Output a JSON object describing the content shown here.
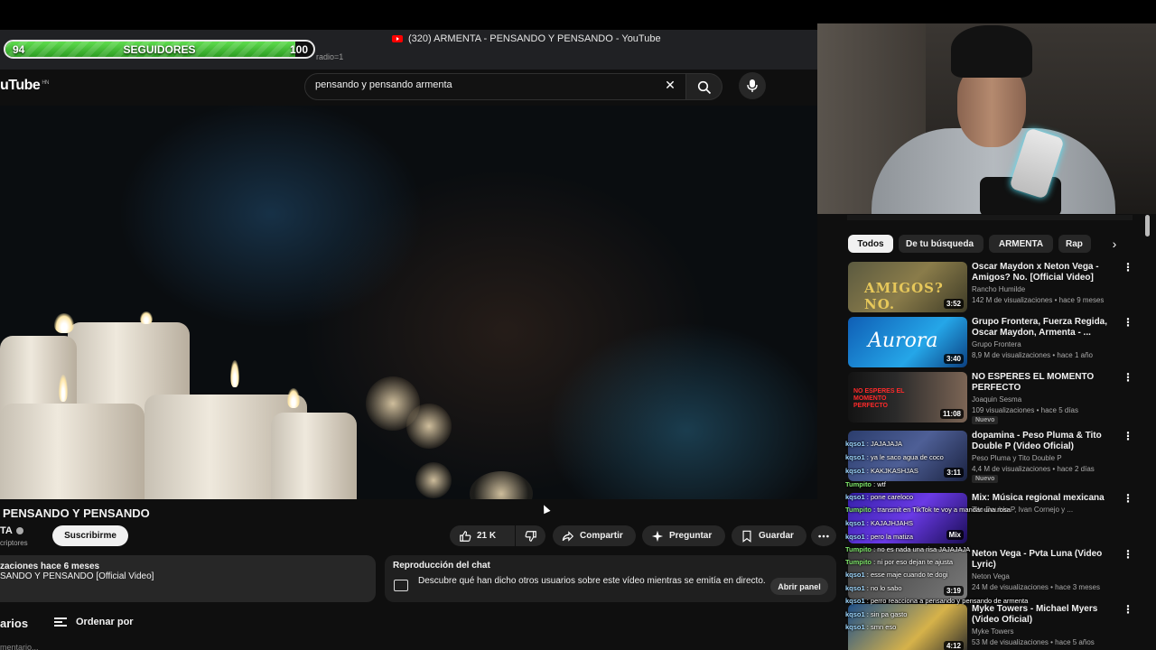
{
  "browser": {
    "tab_title": "(320) ARMENTA - PENSANDO Y PENSANDO - YouTube",
    "url_fragment": "radio=1"
  },
  "followers_bar": {
    "current": "94",
    "label": "SEGUIDORES",
    "goal": "100",
    "progress_fraction": 0.94,
    "fill_color": "#4cc63c"
  },
  "header": {
    "logo_text": "uTube",
    "logo_region": "HN",
    "search_value": "pensando y pensando armenta",
    "clear_icon": "close-icon",
    "search_icon": "search-icon",
    "mic_icon": "mic-icon"
  },
  "video": {
    "title": "PENSANDO Y PENSANDO",
    "channel": "TA",
    "subscribers": "criptores",
    "subscribe_label": "Suscribirme",
    "likes": "21 K",
    "share_label": "Compartir",
    "ask_label": "Preguntar",
    "save_label": "Guardar",
    "description_meta": "zaciones  hace 6 meses",
    "description_text": "SANDO Y PENSANDO [Official Video]"
  },
  "chat_replay": {
    "title": "Reproducción del chat",
    "description": "Descubre qué han dicho otros usuarios sobre este vídeo mientras se emitía en directo.",
    "button": "Abrir panel"
  },
  "comments": {
    "title": "arios",
    "sort_label": "Ordenar por",
    "add_placeholder": "mentario..."
  },
  "sidebar": {
    "chips": [
      "Todos",
      "De tu búsqueda",
      "ARMENTA",
      "Rap"
    ],
    "active_chip": "Todos",
    "recommendations": [
      {
        "title": "Oscar Maydon x Neton Vega - Amigos? No. [Official Video]",
        "channel": "Rancho Humilde",
        "views": "142 M de visualizaciones • hace 9 meses",
        "duration": "3:52",
        "thumb_text": "AMIGOS? NO.",
        "badge": ""
      },
      {
        "title": "Grupo Frontera, Fuerza Regida, Oscar Maydon, Armenta - ...",
        "channel": "Grupo Frontera",
        "views": "8,9 M de visualizaciones • hace 1 año",
        "duration": "3:40",
        "thumb_text": "Aurora",
        "badge": ""
      },
      {
        "title": "NO ESPERES EL MOMENTO PERFECTO",
        "channel": "Joaquin Sesma",
        "views": "109 visualizaciones • hace 5 días",
        "duration": "11:08",
        "thumb_text": "NO ESPERES EL MOMENTO PERFECTO",
        "badge": "Nuevo"
      },
      {
        "title": "dopamina - Peso Pluma & Tito Double P (Video Oficial)",
        "channel": "Peso Pluma  y Tito Double P",
        "views": "4,4 M de visualizaciones • hace 2 días",
        "duration": "3:11",
        "thumb_text": "",
        "badge": "Nuevo"
      },
      {
        "title": "Mix: Música regional mexicana",
        "channel": "Tito Double P, Ivan Cornejo y ...",
        "views": "",
        "duration": "Mix",
        "thumb_text": "",
        "badge": ""
      },
      {
        "title": "Neton Vega - Pvta Luna (Video Lyric)",
        "channel": "Neton Vega",
        "views": "24 M de visualizaciones • hace 3 meses",
        "duration": "3:19",
        "thumb_text": "",
        "badge": ""
      },
      {
        "title": "Myke Towers - Michael Myers (Video Oficial)",
        "channel": "Myke Towers",
        "views": "53 M de visualizaciones • hace 5 años",
        "duration": "4:12",
        "thumb_text": "",
        "badge": ""
      }
    ]
  },
  "live_chat": [
    {
      "user": "kqso1",
      "text": "JAJAJAJA"
    },
    {
      "user": "kqso1",
      "text": "ya le saco agua de coco"
    },
    {
      "user": "kqso1",
      "text": "KAKJKASHJAS"
    },
    {
      "user": "Tumpito",
      "text": "wtf"
    },
    {
      "user": "kqso1",
      "text": "pone careloco"
    },
    {
      "user": "Tumpito",
      "text": "transmit en TikTok te voy a mandar una rosa"
    },
    {
      "user": "kqso1",
      "text": "KAJAJHJAHS"
    },
    {
      "user": "kqso1",
      "text": "pero la matiza"
    },
    {
      "user": "Tumpito",
      "text": "no es nada una risa JAJAJAJA"
    },
    {
      "user": "Tumpito",
      "text": "ni por eso dejan te ajusta"
    },
    {
      "user": "kqso1",
      "text": "esse maje cuando te dogi"
    },
    {
      "user": "kqso1",
      "text": "no lo sabo"
    },
    {
      "user": "kqso1",
      "text": "perro reacciona a pensando y pensando de armenta"
    },
    {
      "user": "kqso1",
      "text": "sin pa gasto"
    },
    {
      "user": "kqso1",
      "text": "smn eso"
    }
  ]
}
